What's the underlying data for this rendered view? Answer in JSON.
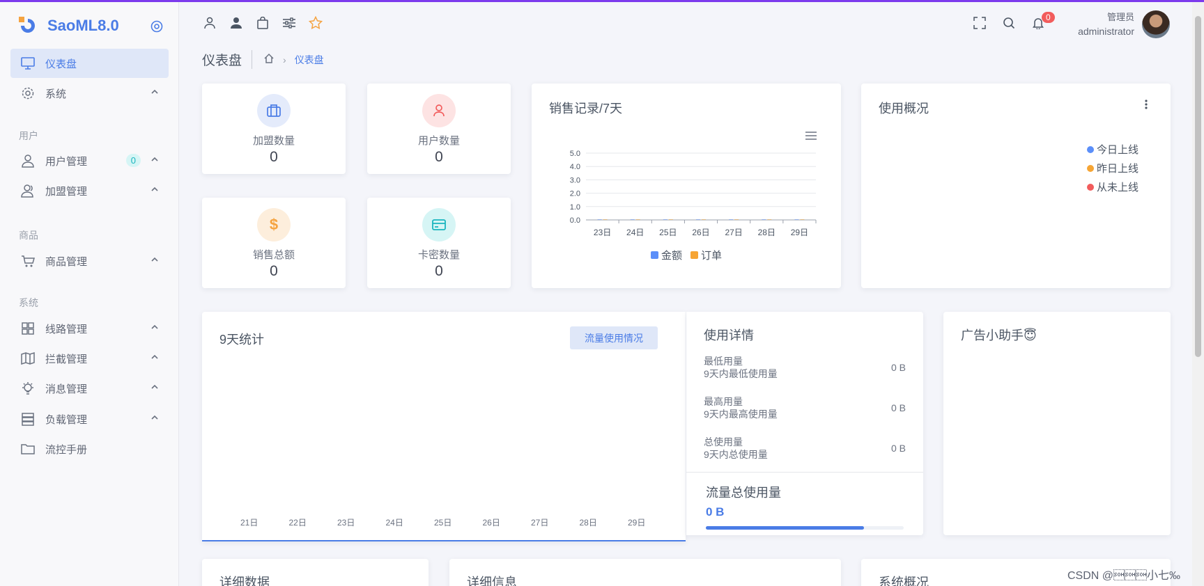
{
  "app": {
    "title": "SaoML8.0"
  },
  "sidebar": {
    "items": [
      {
        "label": "仪表盘",
        "icon": "monitor-icon",
        "active": true
      },
      {
        "label": "系统",
        "icon": "gear-icon"
      },
      {
        "label": "用户管理",
        "icon": "user-icon",
        "badge": "0"
      },
      {
        "label": "加盟管理",
        "icon": "users-icon"
      },
      {
        "label": "商品管理",
        "icon": "cart-icon"
      },
      {
        "label": "线路管理",
        "icon": "grid-icon"
      },
      {
        "label": "拦截管理",
        "icon": "map-icon"
      },
      {
        "label": "消息管理",
        "icon": "bulb-icon"
      },
      {
        "label": "负载管理",
        "icon": "server-icon"
      },
      {
        "label": "流控手册",
        "icon": "folder-icon"
      }
    ],
    "sections": [
      "用户",
      "商品",
      "系统"
    ]
  },
  "header": {
    "notif_count": "0",
    "user_role": "管理员",
    "user_name": "administrator"
  },
  "breadcrumb": {
    "title": "仪表盘",
    "current": "仪表盘"
  },
  "stats": [
    {
      "label": "加盟数量",
      "value": "0",
      "icon": "bag-icon",
      "bg": "#e4ebfb",
      "fg": "#4a7ce6"
    },
    {
      "label": "用户数量",
      "value": "0",
      "icon": "user-icon",
      "bg": "#fde3e3",
      "fg": "#f25c5c"
    },
    {
      "label": "销售总额",
      "value": "0",
      "icon": "dollar-icon",
      "bg": "#fdeedc",
      "fg": "#f5a340"
    },
    {
      "label": "卡密数量",
      "value": "0",
      "icon": "card-icon",
      "bg": "#d6f5f5",
      "fg": "#19b5be"
    }
  ],
  "sales_card": {
    "title": "销售记录/7天"
  },
  "chart_data": [
    {
      "type": "bar",
      "title": "销售记录/7天",
      "categories": [
        "23日",
        "24日",
        "25日",
        "26日",
        "27日",
        "28日",
        "29日"
      ],
      "series": [
        {
          "name": "金额",
          "values": [
            0,
            0,
            0,
            0,
            0,
            0,
            0
          ],
          "color": "#5b8ff9"
        },
        {
          "name": "订单",
          "values": [
            0,
            0,
            0,
            0,
            0,
            0,
            0
          ],
          "color": "#f6a534"
        }
      ],
      "yticks": [
        "5.0",
        "4.0",
        "3.0",
        "2.0",
        "1.0",
        "0.0"
      ],
      "ylim": [
        0,
        5
      ],
      "grid": true,
      "legend": "bottom"
    },
    {
      "type": "bar",
      "title": "9天统计",
      "categories": [
        "21日",
        "22日",
        "23日",
        "24日",
        "25日",
        "26日",
        "27日",
        "28日",
        "29日"
      ],
      "series": [],
      "grid": false
    }
  ],
  "usage_overview": {
    "title": "使用概况",
    "legend": [
      {
        "label": "今日上线",
        "color": "#5b8ff9"
      },
      {
        "label": "昨日上线",
        "color": "#f6a534"
      },
      {
        "label": "从未上线",
        "color": "#f25c5c"
      }
    ]
  },
  "nine_days": {
    "title": "9天统计",
    "button": "流量使用情况"
  },
  "usage_detail": {
    "title": "使用详情",
    "rows": [
      {
        "name": "最低用量",
        "desc": "9天内最低使用量",
        "value": "0 B"
      },
      {
        "name": "最高用量",
        "desc": "9天内最高使用量",
        "value": "0 B"
      },
      {
        "name": "总使用量",
        "desc": "9天内总使用量",
        "value": "0 B"
      }
    ],
    "total_label": "流量总使用量",
    "total_value": "0 B",
    "progress": 0.8
  },
  "ad_card": {
    "title": "广告小助手😇"
  },
  "bottom_cards": [
    "详细数据",
    "详细信息",
    "系统概况"
  ],
  "watermark": "CSDN @\u0001\u0001\u0001小七‰"
}
